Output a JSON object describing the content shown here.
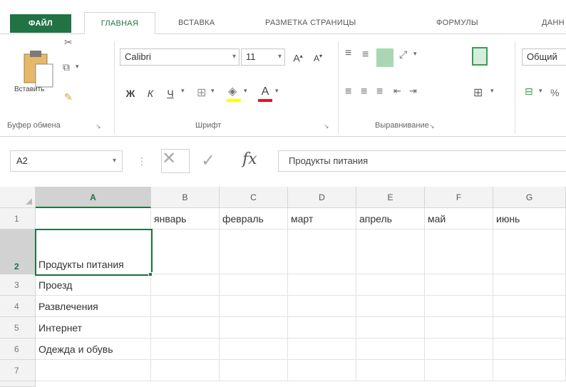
{
  "ribbon_tabs": {
    "file": "ФАЙЛ",
    "home": "ГЛАВНАЯ",
    "insert": "ВСТАВКА",
    "page_layout": "РАЗМЕТКА СТРАНИЦЫ",
    "formulas": "ФОРМУЛЫ",
    "data": "ДАНН"
  },
  "clipboard": {
    "paste_label": "Вставить",
    "group_label": "Буфер обмена"
  },
  "font": {
    "name": "Calibri",
    "size": "11",
    "bold": "Ж",
    "italic": "К",
    "underline": "Ч",
    "group_label": "Шрифт"
  },
  "alignment": {
    "group_label": "Выравнивание"
  },
  "number": {
    "format": "Общий"
  },
  "formula_bar": {
    "name_box": "A2",
    "fx": "fx",
    "content": "Продукты питания"
  },
  "sheet": {
    "columns": [
      "A",
      "B",
      "C",
      "D",
      "E",
      "F",
      "G"
    ],
    "rows": [
      "1",
      "2",
      "3",
      "4",
      "5",
      "6",
      "7"
    ],
    "selected_cell": "A2",
    "cells": {
      "B1": "январь",
      "C1": "февраль",
      "D1": "март",
      "E1": "апрель",
      "F1": "май",
      "G1": "июнь",
      "A2": "Продукты питания",
      "A3": "Проезд",
      "A4": "Развлечения",
      "A5": "Интернет",
      "A6": "Одежда и обувь"
    }
  },
  "colors": {
    "accent": "#217346",
    "header_bg": "#f3f3f3",
    "selected_header_bg": "#d2d2d2",
    "gridline": "#e2e2e2"
  }
}
